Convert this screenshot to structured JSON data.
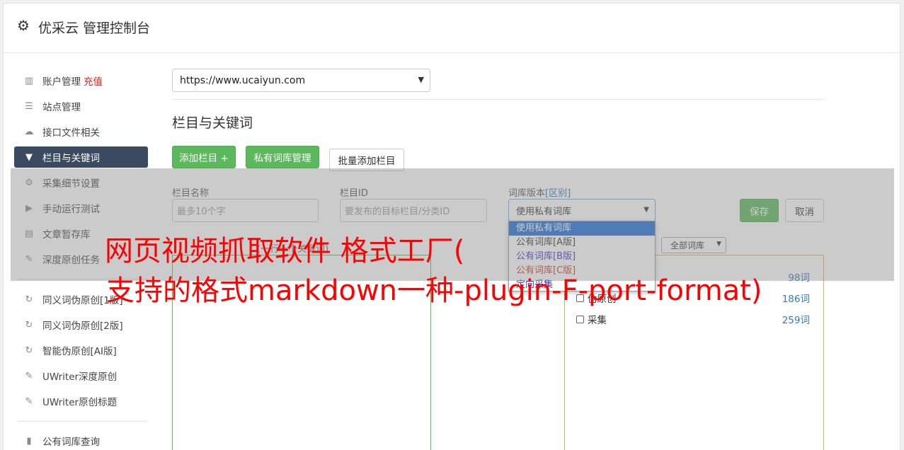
{
  "header": {
    "title": "优采云 管理控制台",
    "icon": "gear-icon"
  },
  "sidebar": {
    "items": [
      {
        "label": "账户管理",
        "badge": "充值",
        "icon": "bar-chart-icon"
      },
      {
        "label": "站点管理",
        "icon": "server-icon"
      },
      {
        "label": "接口文件相关",
        "icon": "cloud-upload-icon"
      },
      {
        "label": "栏目与关键词",
        "icon": "filter-icon",
        "active": true
      },
      {
        "label": "采集细节设置",
        "icon": "cogs-icon"
      },
      {
        "label": "手动运行测试",
        "icon": "play-circle-icon"
      },
      {
        "label": "文章暂存库",
        "icon": "database-icon"
      },
      {
        "label": "深度原创任务",
        "icon": "edit-icon"
      },
      {
        "label": "同义词伪原创[1版]",
        "icon": "refresh-icon"
      },
      {
        "label": "同义词伪原创[2版]",
        "icon": "refresh-icon"
      },
      {
        "label": "智能伪原创[AI版]",
        "icon": "refresh-icon"
      },
      {
        "label": "UWriter深度原创",
        "icon": "edit-icon"
      },
      {
        "label": "UWriter原创标题",
        "icon": "edit-icon"
      },
      {
        "label": "公有词库查询",
        "icon": "book-icon"
      }
    ]
  },
  "main": {
    "site_select": "https://www.ucaiyun.com",
    "section_title": "栏目与关键词",
    "buttons": {
      "add_column": "添加栏目 +",
      "private_lib": "私有词库管理",
      "batch_add": "批量添加栏目"
    },
    "form": {
      "name_label": "栏目名称",
      "name_placeholder": "最多10个字",
      "id_label": "栏目ID",
      "id_placeholder": "要发布的目标栏目/分类ID",
      "lib_label": "词库版本",
      "lib_label_link": "[区别]",
      "lib_value": "使用私有词库",
      "save": "保存",
      "cancel": "取消"
    },
    "lib_options": [
      "使用私有词库",
      "公有词库[A版]",
      "公有词库[B版]",
      "公有词库[C版]",
      "定向采集"
    ],
    "lib_option_colors": [
      "#ffffff",
      "#333333",
      "#3333cc",
      "#cc3333",
      "#3333cc"
    ],
    "hint_label": "(一行一个关键词)",
    "all_libs": "全部词库",
    "lib_rows": [
      {
        "label": "",
        "count": "98词"
      },
      {
        "label": "伪原创",
        "count": "186词"
      },
      {
        "label": "采集",
        "count": "259词"
      }
    ]
  },
  "overlay": {
    "line1": "网页视频抓取软件 格式工厂(",
    "line2": "支持的格式markdown一种-plugin-F-port-format)"
  }
}
